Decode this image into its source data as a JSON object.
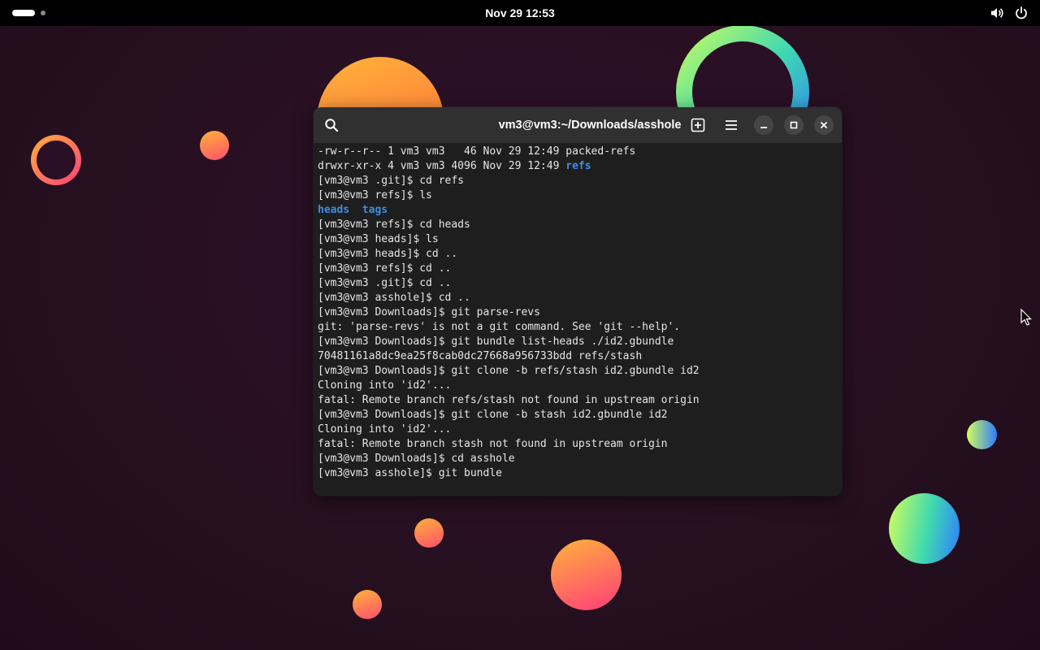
{
  "topbar": {
    "clock": "Nov 29  12:53",
    "icons": [
      "volume-icon",
      "power-icon"
    ]
  },
  "colors": {
    "terminal_bg": "#1e1e1e",
    "titlebar_bg": "#303030",
    "directory_blue": "#3d8de6",
    "text": "#e6e6e6"
  },
  "terminal": {
    "title": "vm3@vm3:~/Downloads/asshole",
    "lines": [
      {
        "segments": [
          {
            "text": "-rw-r--r-- 1 vm3 vm3   46 Nov 29 12:49 packed-refs"
          }
        ]
      },
      {
        "segments": [
          {
            "text": "drwxr-xr-x 4 vm3 vm3 4096 Nov 29 12:49 "
          },
          {
            "text": "refs",
            "dir": true
          }
        ]
      },
      {
        "segments": [
          {
            "text": "[vm3@vm3 .git]$ cd refs"
          }
        ]
      },
      {
        "segments": [
          {
            "text": "[vm3@vm3 refs]$ ls"
          }
        ]
      },
      {
        "segments": [
          {
            "text": "heads",
            "dir": true
          },
          {
            "text": "  "
          },
          {
            "text": "tags",
            "dir": true
          }
        ]
      },
      {
        "segments": [
          {
            "text": "[vm3@vm3 refs]$ cd heads"
          }
        ]
      },
      {
        "segments": [
          {
            "text": "[vm3@vm3 heads]$ ls"
          }
        ]
      },
      {
        "segments": [
          {
            "text": "[vm3@vm3 heads]$ cd .."
          }
        ]
      },
      {
        "segments": [
          {
            "text": "[vm3@vm3 refs]$ cd .."
          }
        ]
      },
      {
        "segments": [
          {
            "text": "[vm3@vm3 .git]$ cd .."
          }
        ]
      },
      {
        "segments": [
          {
            "text": "[vm3@vm3 asshole]$ cd .."
          }
        ]
      },
      {
        "segments": [
          {
            "text": "[vm3@vm3 Downloads]$ git parse-revs"
          }
        ]
      },
      {
        "segments": [
          {
            "text": "git: 'parse-revs' is not a git command. See 'git --help'."
          }
        ]
      },
      {
        "segments": [
          {
            "text": "[vm3@vm3 Downloads]$ git bundle list-heads ./id2.gbundle"
          }
        ]
      },
      {
        "segments": [
          {
            "text": "70481161a8dc9ea25f8cab0dc27668a956733bdd refs/stash"
          }
        ]
      },
      {
        "segments": [
          {
            "text": "[vm3@vm3 Downloads]$ git clone -b refs/stash id2.gbundle id2"
          }
        ]
      },
      {
        "segments": [
          {
            "text": "Cloning into 'id2'..."
          }
        ]
      },
      {
        "segments": [
          {
            "text": "fatal: Remote branch refs/stash not found in upstream origin"
          }
        ]
      },
      {
        "segments": [
          {
            "text": "[vm3@vm3 Downloads]$ git clone -b stash id2.gbundle id2"
          }
        ]
      },
      {
        "segments": [
          {
            "text": "Cloning into 'id2'..."
          }
        ]
      },
      {
        "segments": [
          {
            "text": "fatal: Remote branch stash not found in upstream origin"
          }
        ]
      },
      {
        "segments": [
          {
            "text": "[vm3@vm3 Downloads]$ cd asshole"
          }
        ]
      },
      {
        "segments": [
          {
            "text": "[vm3@vm3 asshole]$ git bundle"
          }
        ]
      }
    ]
  }
}
